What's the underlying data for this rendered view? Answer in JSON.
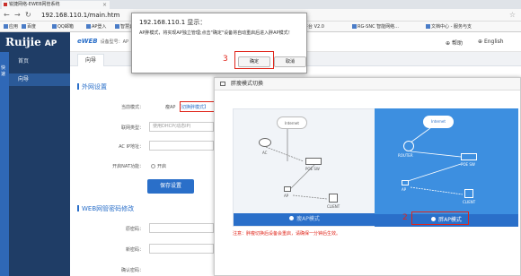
{
  "browser": {
    "tab_title": "锐捷网络-EWEB网管系统",
    "tab_close": "×",
    "url": "192.168.110.1/main.htm",
    "bookmarks": [
      {
        "label": "应用"
      },
      {
        "label": "百度"
      },
      {
        "label": "QQ邮箱"
      },
      {
        "label": "AP登入"
      },
      {
        "label": "智慧云"
      },
      {
        "label": "上网"
      },
      {
        "label": "企业管理平台 V2.0"
      },
      {
        "label": "RG-SNC 智能网络..."
      },
      {
        "label": "文档中心 - 服务与支"
      }
    ]
  },
  "app": {
    "logo": "Ruijie",
    "logo_suffix": "AP",
    "eweb": "eWEB",
    "eweb_sub": "设备型号：AP",
    "header_help": "帮助",
    "header_lang": "English"
  },
  "sidebar": {
    "strip_label": "快速",
    "items": [
      {
        "label": "首页"
      },
      {
        "label": "向导"
      }
    ]
  },
  "content": {
    "tab": "向导",
    "section_wan": "外网设置",
    "current_mode_label": "当前模式：",
    "current_mode_value": "瘦AP",
    "switch_mode_link": "【切换胖模式】",
    "link_type_label": "联网类型：",
    "link_type_value": "使用DHCP(动态IP)",
    "ac_ip_label": "AC IP地址：",
    "nat_label": "开启NAT功能：",
    "nat_value": "开启",
    "save_button": "保存设置",
    "section_pwd": "WEB网管密码修改",
    "old_pwd_label": "原密码：",
    "new_pwd_label": "新密码：",
    "confirm_pwd_label": "确认密码："
  },
  "overlay": {
    "title": "胖瘦模式切换",
    "panel_a": {
      "internet": "Internet",
      "ac": "AC",
      "poe": "POE SW",
      "ap": "AP",
      "client": "CLIENT",
      "footer": "瘦AP模式"
    },
    "panel_b": {
      "internet": "Internet",
      "router": "ROUTER",
      "poe": "POE SW",
      "ap": "AP",
      "client": "CLIENT",
      "footer": "胖AP模式"
    },
    "warning": "注意：胖瘦切换后设备会重启，请确保一分钟后生效。"
  },
  "dialog": {
    "title": "192.168.110.1 显示：",
    "message": "AP胖模式，将实现AP独立管理;点击\"确定\"设备将自动重启后进入胖AP模式！",
    "ok": "确定",
    "cancel": "取消"
  },
  "annotations": {
    "step1": "1",
    "step2": "2",
    "step3": "3"
  },
  "colors": {
    "brand": "#1f3d66",
    "accent": "#2a6fc9",
    "highlight": "#e0261b"
  }
}
